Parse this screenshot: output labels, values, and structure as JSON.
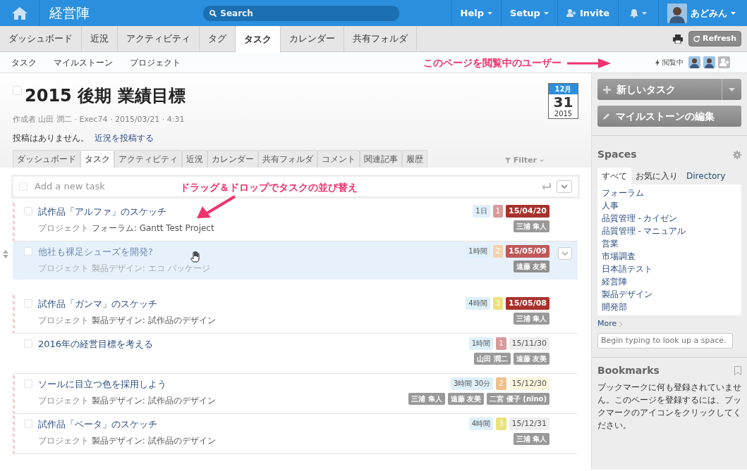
{
  "header": {
    "app_title": "経営陣",
    "search_placeholder": "Search",
    "menus": [
      {
        "kind": "dropdown",
        "label": "Help"
      },
      {
        "kind": "dropdown",
        "label": "Setup"
      },
      {
        "kind": "invite",
        "label": "Invite"
      },
      {
        "kind": "bell"
      }
    ],
    "user": "あどみん"
  },
  "main_tabs": [
    {
      "label": "ダッシュボード",
      "selected": false
    },
    {
      "label": "近況",
      "selected": false
    },
    {
      "label": "アクティビティ",
      "selected": false
    },
    {
      "label": "タグ",
      "selected": false
    },
    {
      "label": "タスク",
      "selected": true
    },
    {
      "label": "カレンダー",
      "selected": false
    },
    {
      "label": "共有フォルダ",
      "selected": false
    }
  ],
  "refresh": "Refresh",
  "sub_nav": [
    "タスク",
    "マイルストーン",
    "プロジェクト"
  ],
  "viewers_label": "閲覧中",
  "annotations": [
    {
      "text": "このページを閲覧中のユーザー"
    },
    {
      "text": "ドラッグ＆ドロップでタスクの並び替え"
    }
  ],
  "milestone": {
    "title": "2015 後期 業績目標",
    "checked": false,
    "meta": "作成者 山田 潤二 · Exec74 · 2015/03/21 · 4:31",
    "no_posts": "投稿はありません。",
    "post_link": "近況を投稿する",
    "due": {
      "month": "12月",
      "day": "31",
      "year": "2015"
    }
  },
  "detail_tabs": [
    {
      "label": "ダッシュボード",
      "selected": false
    },
    {
      "label": "タスク",
      "selected": true
    },
    {
      "label": "アクティビティ",
      "selected": false
    },
    {
      "label": "近況",
      "selected": false
    },
    {
      "label": "カレンダー",
      "selected": false
    },
    {
      "label": "共有フォルダ",
      "selected": false
    },
    {
      "label": "コメント",
      "selected": false
    },
    {
      "label": "関連記事",
      "selected": false
    },
    {
      "label": "履歴",
      "selected": false
    }
  ],
  "filter": "Filter",
  "new_task": {
    "placeholder": "Add a new task",
    "checked": false
  },
  "tasks": [
    {
      "title": "試作品「アルファ」のスケッチ",
      "project_label": "プロジェクト",
      "project": "フォーラム: Gantt Test Project",
      "duration": "1日",
      "priority": {
        "text": "1",
        "color": "#d99a9a"
      },
      "due": {
        "text": "15/04/20",
        "color": "#a8322d"
      },
      "assignees": [
        "三浦 隼人"
      ],
      "flagged": true,
      "dragging": false,
      "checked": false
    },
    {
      "title": "他社も裸足シューズを開発?",
      "project_label": "プロジェクト",
      "project": "製品デザイン: エコ パッケージ",
      "duration": "1時間",
      "priority": {
        "text": "2",
        "color": "#f5d3ae"
      },
      "due": {
        "text": "15/05/09",
        "color": "#c0585a"
      },
      "assignees": [
        "遠藤 友美"
      ],
      "flagged": false,
      "dragging": true,
      "checked": false
    },
    {
      "title": "試作品「ガンマ」のスケッチ",
      "project_label": "プロジェクト",
      "project": "製品デザイン: 試作品のデザイン",
      "duration": "4時間",
      "priority": {
        "text": "3",
        "color": "#ece27c"
      },
      "due": {
        "text": "15/05/08",
        "color": "#a8322d"
      },
      "assignees": [
        "三浦 隼人"
      ],
      "flagged": true,
      "dragging": false,
      "checked": false
    },
    {
      "title": "2016年の経営目標を考える",
      "duration": "1時間",
      "priority": {
        "text": "1",
        "color": "#d99a9a"
      },
      "due": {
        "text": "15/11/30",
        "color": "#eeeeee"
      },
      "assignees": [
        "山田 潤二",
        "遠藤 友美"
      ],
      "flagged": false,
      "dragging": false,
      "checked": false
    },
    {
      "title": "ソールに目立つ色を採用しよう",
      "project_label": "プロジェクト",
      "project": "製品デザイン: 試作品のデザイン",
      "duration": "3時間 30分",
      "priority": {
        "text": "2",
        "color": "#f0c08a"
      },
      "due": {
        "text": "15/12/30",
        "color": "#fdf5df"
      },
      "assignees": [
        "三浦 隼人",
        "遠藤 友美",
        "二宮 優子 (nino)"
      ],
      "flagged": true,
      "dragging": false,
      "checked": false
    },
    {
      "title": "試作品「ベータ」のスケッチ",
      "project_label": "プロジェクト",
      "project": "製品デザイン: 試作品のデザイン",
      "duration": "4時間",
      "priority": {
        "text": "3",
        "color": "#ece27c"
      },
      "due": {
        "text": "15/12/31",
        "color": "#eeeeee"
      },
      "assignees": [
        "三浦 隼人"
      ],
      "flagged": true,
      "dragging": false,
      "checked": false
    }
  ],
  "sidebar": {
    "new_task_button": "新しいタスク",
    "edit_milestone_button": "マイルストーンの編集",
    "spaces": {
      "title": "Spaces",
      "tabs": [
        {
          "label": "すべて",
          "selected": true
        },
        {
          "label": "お気に入り",
          "selected": false
        },
        {
          "label": "Directory",
          "selected": false
        }
      ],
      "items": [
        "フォーラム",
        "人事",
        "品質管理 - カイゼン",
        "品質管理 - マニュアル",
        "営業",
        "市場調査",
        "日本語テスト",
        "経営陣",
        "製品デザイン",
        "開発部"
      ],
      "more": "More",
      "lookup_placeholder": "Begin typing to look up a space."
    },
    "bookmarks": {
      "title": "Bookmarks",
      "text": "ブックマークに何も登録されていません。このページを登録するには、ブックマークのアイコンをクリックしてください。"
    }
  }
}
